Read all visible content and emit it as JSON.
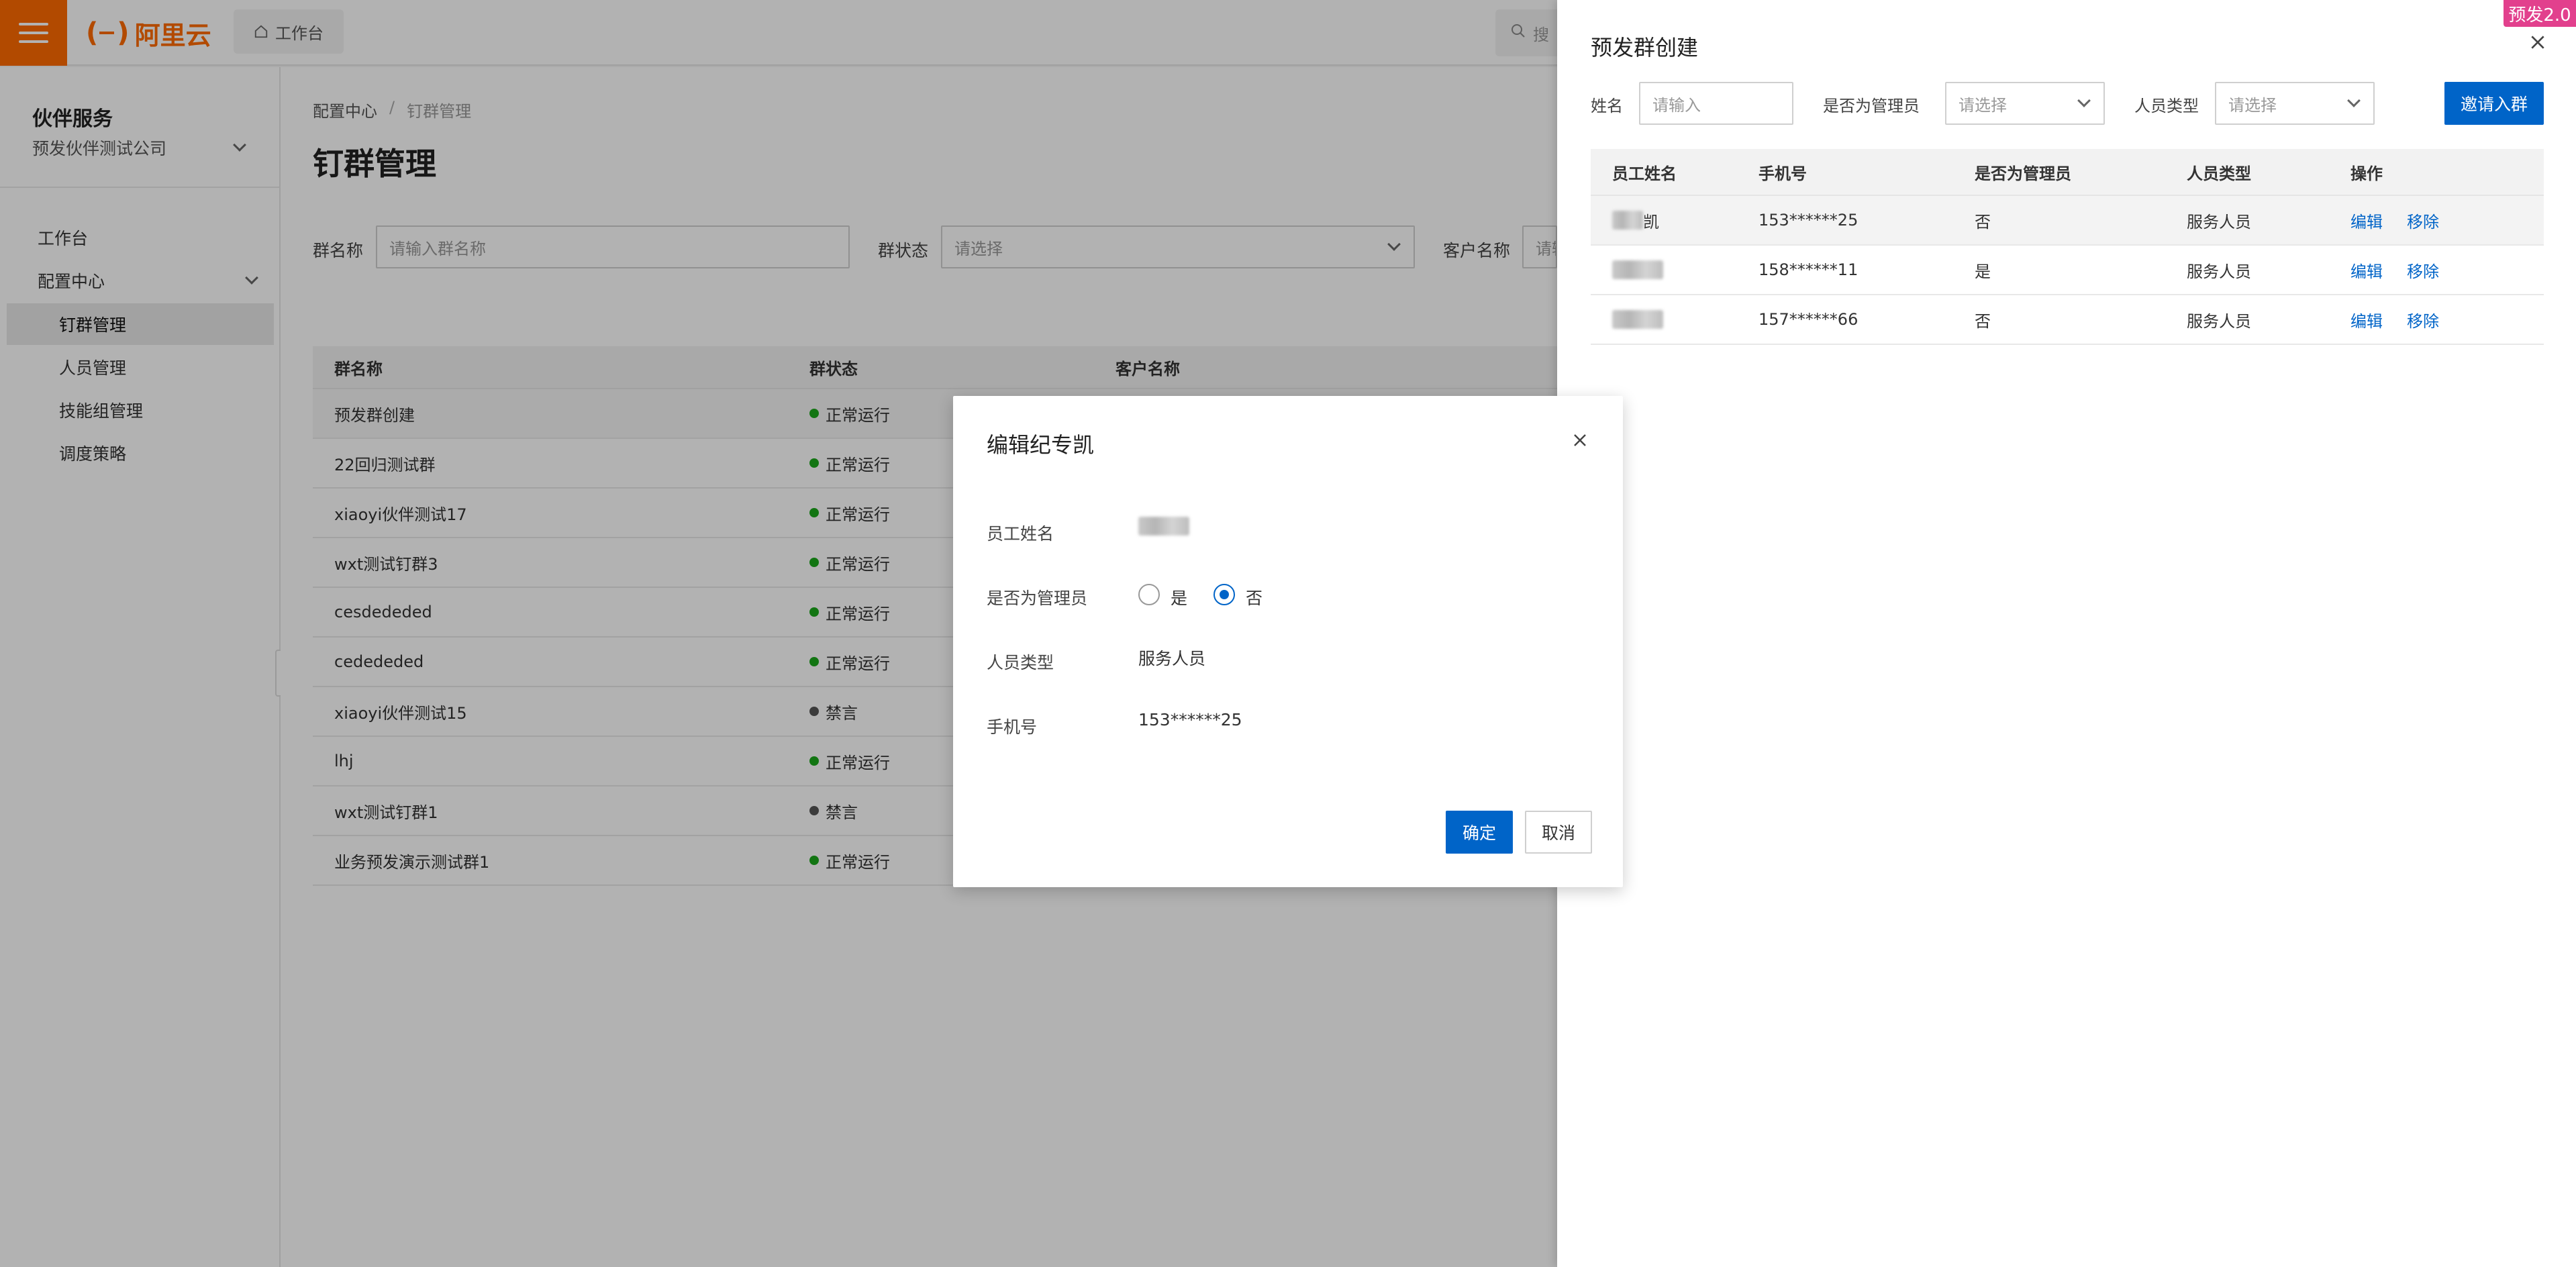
{
  "topbar": {
    "brand": "阿里云",
    "workbench_tab": "工作台",
    "search_placeholder": "搜"
  },
  "sidebar": {
    "title": "伙伴服务",
    "company": "预发伙伴测试公司",
    "workbench": "工作台",
    "group": "配置中心",
    "items": [
      {
        "label": "钉群管理"
      },
      {
        "label": "人员管理"
      },
      {
        "label": "技能组管理"
      },
      {
        "label": "调度策略"
      }
    ]
  },
  "main": {
    "breadcrumb": [
      "配置中心",
      "/",
      "钉群管理"
    ],
    "title": "钉群管理",
    "filters": {
      "group_name_label": "群名称",
      "group_name_placeholder": "请输入群名称",
      "status_label": "群状态",
      "status_placeholder": "请选择",
      "customer_label": "客户名称",
      "customer_placeholder": "请输"
    },
    "table": {
      "headers": [
        "群名称",
        "群状态",
        "客户名称"
      ],
      "rows": [
        {
          "name": "预发群创建",
          "status": "正常运行",
          "status_color": "#1ba81b"
        },
        {
          "name": "22回归测试群",
          "status": "正常运行",
          "status_color": "#1ba81b"
        },
        {
          "name": "xiaoyi伙伴测试17",
          "status": "正常运行",
          "status_color": "#1ba81b"
        },
        {
          "name": "wxt测试钉群3",
          "status": "正常运行",
          "status_color": "#1ba81b"
        },
        {
          "name": "cesdededed",
          "status": "正常运行",
          "status_color": "#1ba81b"
        },
        {
          "name": "cedededed",
          "status": "正常运行",
          "status_color": "#1ba81b"
        },
        {
          "name": "xiaoyi伙伴测试15",
          "status": "禁言",
          "status_color": "#555555"
        },
        {
          "name": "lhj",
          "status": "正常运行",
          "status_color": "#1ba81b"
        },
        {
          "name": "wxt测试钉群1",
          "status": "禁言",
          "status_color": "#555555"
        },
        {
          "name": "业务预发演示测试群1",
          "status": "正常运行",
          "status_color": "#1ba81b"
        }
      ]
    }
  },
  "drawer": {
    "title": "预发群创建",
    "badge": "预发2.0",
    "filters": {
      "name_label": "姓名",
      "name_placeholder": "请输入",
      "admin_label": "是否为管理员",
      "admin_placeholder": "请选择",
      "type_label": "人员类型",
      "type_placeholder": "请选择"
    },
    "invite_button": "邀请入群",
    "table": {
      "headers": [
        "员工姓名",
        "手机号",
        "是否为管理员",
        "人员类型",
        "操作"
      ],
      "rows": [
        {
          "name_suffix": "凯",
          "phone": "153******25",
          "admin": "否",
          "type": "服务人员"
        },
        {
          "name_suffix": "",
          "phone": "158******11",
          "admin": "是",
          "type": "服务人员"
        },
        {
          "name_suffix": "",
          "phone": "157******66",
          "admin": "否",
          "type": "服务人员"
        }
      ],
      "edit_label": "编辑",
      "remove_label": "移除"
    }
  },
  "modal": {
    "title": "编辑纪专凯",
    "name_label": "员工姓名",
    "admin_label": "是否为管理员",
    "admin_yes": "是",
    "admin_no": "否",
    "admin_selected": "否",
    "type_label": "人员类型",
    "type_value": "服务人员",
    "phone_label": "手机号",
    "phone_value": "153******25",
    "ok_button": "确定",
    "cancel_button": "取消"
  },
  "colors": {
    "brand_orange": "#ff6a00",
    "primary_blue": "#0064c8",
    "badge_pink": "#e2408d"
  }
}
